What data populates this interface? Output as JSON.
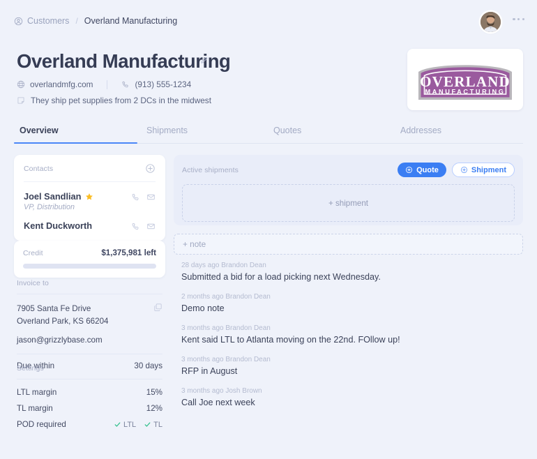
{
  "breadcrumb": {
    "home_label": "Customers",
    "separator": "/",
    "current_label": "Overland Manufacturing",
    "home_icon": "user-circle-icon"
  },
  "topbar": {
    "avatar_name": "user-avatar",
    "menu_icon": "more-horizontal-icon"
  },
  "header": {
    "title": "Overland Manufacturing",
    "edit_icon": "pencil-icon",
    "website": "overlandmfg.com",
    "website_icon": "globe-icon",
    "phone": "(913) 555-1234",
    "phone_icon": "phone-icon",
    "note": "They ship pet supplies from 2 DCs in the midwest",
    "note_icon": "sticky-note-icon"
  },
  "logo": {
    "primary_text": "OVERLAND",
    "secondary_text": "MANUFACTURING",
    "color": "#9a5a9e"
  },
  "tabs": [
    {
      "label": "Overview",
      "active": true
    },
    {
      "label": "Shipments",
      "active": false
    },
    {
      "label": "Quotes",
      "active": false
    },
    {
      "label": "Addresses",
      "active": false
    }
  ],
  "contacts": {
    "title": "Contacts",
    "add_icon": "plus-circle-icon",
    "items": [
      {
        "name": "Joel Sandlian",
        "role": "VP, Distribution",
        "starred": true,
        "star_icon": "star-icon",
        "call_icon": "phone-icon",
        "mail_icon": "envelope-icon"
      },
      {
        "name": "Kent Duckworth",
        "role": "",
        "starred": false,
        "call_icon": "phone-icon",
        "mail_icon": "envelope-icon"
      }
    ]
  },
  "credit": {
    "label": "Credit",
    "value": "$1,375,981 left",
    "percent": 100
  },
  "invoice": {
    "label": "Invoice to",
    "address_line1": "7905 Santa Fe Drive",
    "address_line2": "Overland Park, KS 66204",
    "email": "jason@grizzlybase.com",
    "copy_icon": "copy-icon",
    "due_label": "Due within",
    "due_value": "30 days"
  },
  "settings": {
    "label": "Settings",
    "rows": [
      {
        "label": "LTL margin",
        "value": "15%"
      },
      {
        "label": "TL margin",
        "value": "12%"
      }
    ],
    "pod_label": "POD required",
    "pod_checks": [
      {
        "label": "LTL",
        "icon": "check-icon"
      },
      {
        "label": "TL",
        "icon": "check-icon"
      }
    ],
    "check_color": "#2fc08a"
  },
  "shipments": {
    "title": "Active shipments",
    "quote_button": "Quote",
    "shipment_button": "Shipment",
    "button_icon": "plus-circle-icon",
    "empty_label": "+ shipment",
    "accent_color": "#3b7ef3"
  },
  "notes": {
    "add_placeholder": "+ note",
    "items": [
      {
        "meta": "28 days ago Brandon Dean",
        "body": "Submitted a bid for a load picking next Wednesday."
      },
      {
        "meta": "2 months ago Brandon Dean",
        "body": "Demo note"
      },
      {
        "meta": "3 months ago Brandon Dean",
        "body": "Kent said LTL to Atlanta moving on the 22nd. FOllow up!"
      },
      {
        "meta": "3 months ago Brandon Dean",
        "body": "RFP in August"
      },
      {
        "meta": "3 months ago Josh Brown",
        "body": "Call Joe next week"
      }
    ]
  }
}
